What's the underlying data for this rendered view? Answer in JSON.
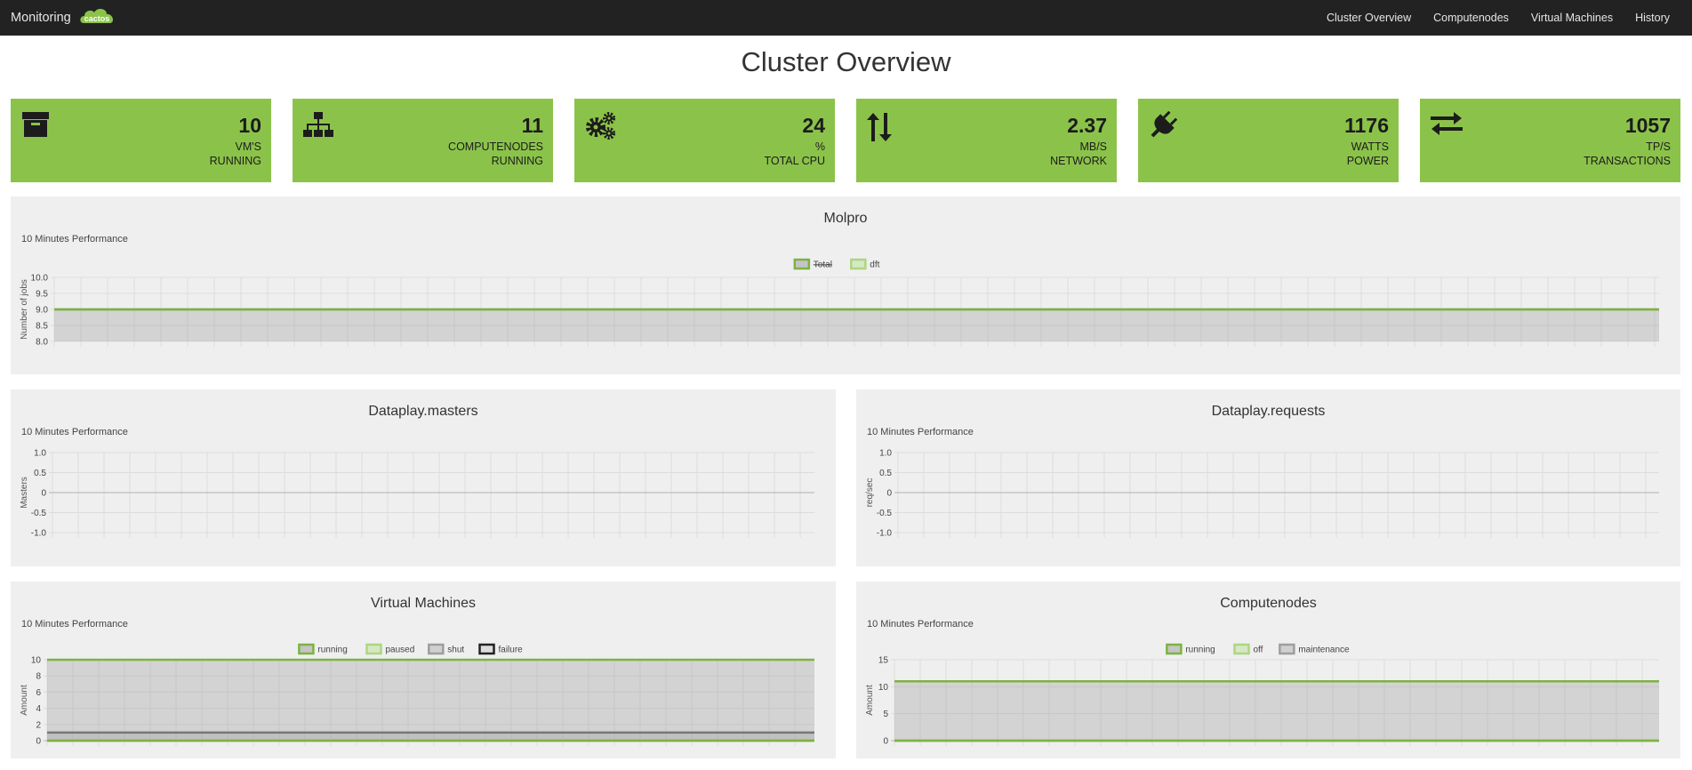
{
  "navbar": {
    "brand": "Monitoring",
    "logo_text": "cactos",
    "links": [
      "Cluster Overview",
      "Computenodes",
      "Virtual Machines",
      "History"
    ]
  },
  "page_title": "Cluster Overview",
  "colors": {
    "green": "#8bc34a",
    "line_green": "#7cb342",
    "light_green": "#aed581",
    "grey": "#9e9e9e",
    "dark": "#222222"
  },
  "stats": [
    {
      "icon": "archive-icon",
      "value": "10",
      "unit": "VM'S",
      "label": "RUNNING"
    },
    {
      "icon": "sitemap-icon",
      "value": "11",
      "unit": "COMPUTENODES",
      "label": "RUNNING"
    },
    {
      "icon": "gears-icon",
      "value": "24",
      "unit": "%",
      "label": "TOTAL CPU"
    },
    {
      "icon": "up-down-arrows-icon",
      "value": "2.37",
      "unit": "MB/s",
      "label": "NETWORK"
    },
    {
      "icon": "plug-icon",
      "value": "1176",
      "unit": "WATTS",
      "label": "POWER"
    },
    {
      "icon": "exchange-icon",
      "value": "1057",
      "unit": "TP/S",
      "label": "TRANSACTIONS"
    }
  ],
  "panels": {
    "molpro": {
      "title": "Molpro",
      "subtitle": "10 Minutes Performance"
    },
    "masters": {
      "title": "Dataplay.masters",
      "subtitle": "10 Minutes Performance"
    },
    "requests": {
      "title": "Dataplay.requests",
      "subtitle": "10 Minutes Performance"
    },
    "vms": {
      "title": "Virtual Machines",
      "subtitle": "10 Minutes Performance"
    },
    "nodes": {
      "title": "Computenodes",
      "subtitle": "10 Minutes Performance"
    }
  },
  "chart_data": [
    {
      "id": "molpro",
      "type": "area",
      "ylabel": "Number of jobs",
      "ylim": [
        8,
        10
      ],
      "yticks": [
        "10.0",
        "9.5",
        "9.0",
        "8.5",
        "8.0"
      ],
      "legend": "top-center",
      "series": [
        {
          "name": "Total",
          "value": 9,
          "hidden": true
        },
        {
          "name": "dft",
          "value": 9
        }
      ]
    },
    {
      "id": "masters",
      "type": "line",
      "ylabel": "Masters",
      "ylim": [
        -1,
        1
      ],
      "yticks": [
        "1.0",
        "0.5",
        "0",
        "-0.5",
        "-1.0"
      ],
      "series": []
    },
    {
      "id": "requests",
      "type": "line",
      "ylabel": "req/sec",
      "ylim": [
        -1,
        1
      ],
      "yticks": [
        "1.0",
        "0.5",
        "0",
        "-0.5",
        "-1.0"
      ],
      "series": []
    },
    {
      "id": "vms",
      "type": "area",
      "ylabel": "Amount",
      "ylim": [
        0,
        10
      ],
      "yticks": [
        "10",
        "8",
        "6",
        "4",
        "2",
        "0"
      ],
      "legend": "top-center",
      "series": [
        {
          "name": "running",
          "value": 10
        },
        {
          "name": "paused",
          "value": 0
        },
        {
          "name": "shut",
          "value": 1
        },
        {
          "name": "failure",
          "value": 0
        }
      ]
    },
    {
      "id": "nodes",
      "type": "area",
      "ylabel": "Amount",
      "ylim": [
        0,
        15
      ],
      "yticks": [
        "15",
        "10",
        "5",
        "0"
      ],
      "legend": "top-center",
      "series": [
        {
          "name": "running",
          "value": 11
        },
        {
          "name": "off",
          "value": 0
        },
        {
          "name": "maintenance",
          "value": 0
        }
      ]
    }
  ]
}
